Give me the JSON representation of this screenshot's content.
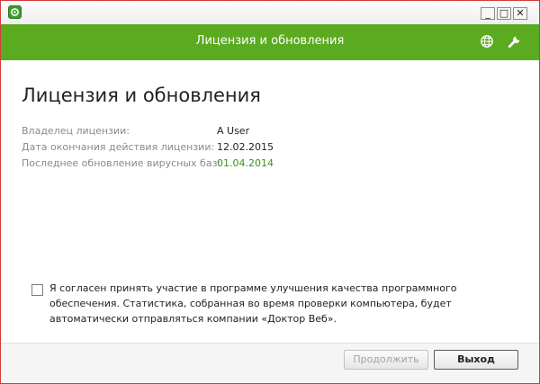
{
  "window": {
    "controls": {
      "minimize": "_",
      "maximize": "□",
      "close": "✕"
    }
  },
  "header": {
    "title": "Лицензия и обновления",
    "icons": [
      "globe-icon",
      "wrench-icon"
    ]
  },
  "main": {
    "title": "Лицензия и обновления",
    "info": [
      {
        "label": "Владелец лицензии:",
        "value": "A User"
      },
      {
        "label": "Дата окончания действия лицензии:",
        "value": "12.02.2015"
      },
      {
        "label": "Последнее обновление вирусных баз:",
        "value": "01.04.2014"
      }
    ],
    "consent": {
      "checked": false,
      "text": "Я согласен принять участие в программе улучшения качества программного обеспечения. Статистика, собранная во время проверки компьютера, будет автоматически отправляться компании «Доктор Веб»."
    }
  },
  "footer": {
    "continue_label": "Продолжить",
    "exit_label": "Выход"
  },
  "colors": {
    "header_bg": "#5bab21",
    "accent_green_text": "#3c8f1a",
    "window_border": "#d23b3b"
  }
}
